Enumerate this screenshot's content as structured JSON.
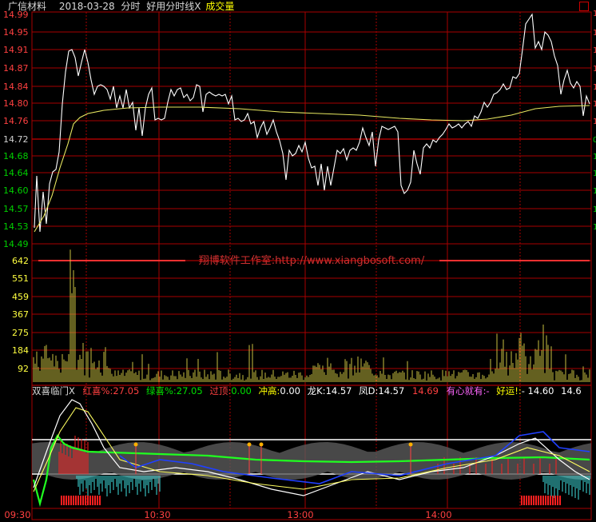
{
  "header": {
    "stock_name": "广信材料",
    "date": "2018-03-28",
    "mode": "分时",
    "indicator_name": "好用分时线X",
    "volume_label": "成交量"
  },
  "colors": {
    "background": "#000000",
    "grid_red": "#a80000",
    "up_red": "#ff4040",
    "down_green": "#00d000",
    "price_line": "#ffffff",
    "avg_line": "#e8e860",
    "volume_bar": "#c8c040",
    "yellow_text": "#ffff00",
    "magenta_text": "#ff66ff"
  },
  "price_axis": {
    "labels": [
      "14.99",
      "14.95",
      "14.91",
      "14.87",
      "14.84",
      "14.80",
      "14.76",
      "14.72",
      "14.68",
      "14.64",
      "14.60",
      "14.57",
      "14.53",
      "14.49"
    ],
    "prev_close": "14.72"
  },
  "volume_axis": {
    "labels": [
      "642",
      "551",
      "459",
      "367",
      "275",
      "184",
      "92"
    ]
  },
  "time_axis": {
    "labels": [
      "09:30",
      "10:30",
      "13:00",
      "14:00"
    ]
  },
  "watermark": "翔博软件工作室:http://www.xiangbosoft.com/",
  "indicator": {
    "name": "双喜临门X",
    "red_label": "红喜%:",
    "red_value": "27.05",
    "green_label": "绿喜%:",
    "green_value": "27.05",
    "top_label": "过顶:",
    "top_value": "0.00",
    "rush_label": "冲高:",
    "rush_value": "0.00",
    "dragon_label": "龙K:",
    "dragon_value": "14.57",
    "phoenix_label": "凤D:",
    "phoenix_value": "14.57",
    "price_value": "14.69",
    "heart_label": "有心就有:",
    "heart_value": "-",
    "luck_label": "好运!:",
    "luck_value": "- 14.60",
    "tail_value": "14.6"
  }
}
